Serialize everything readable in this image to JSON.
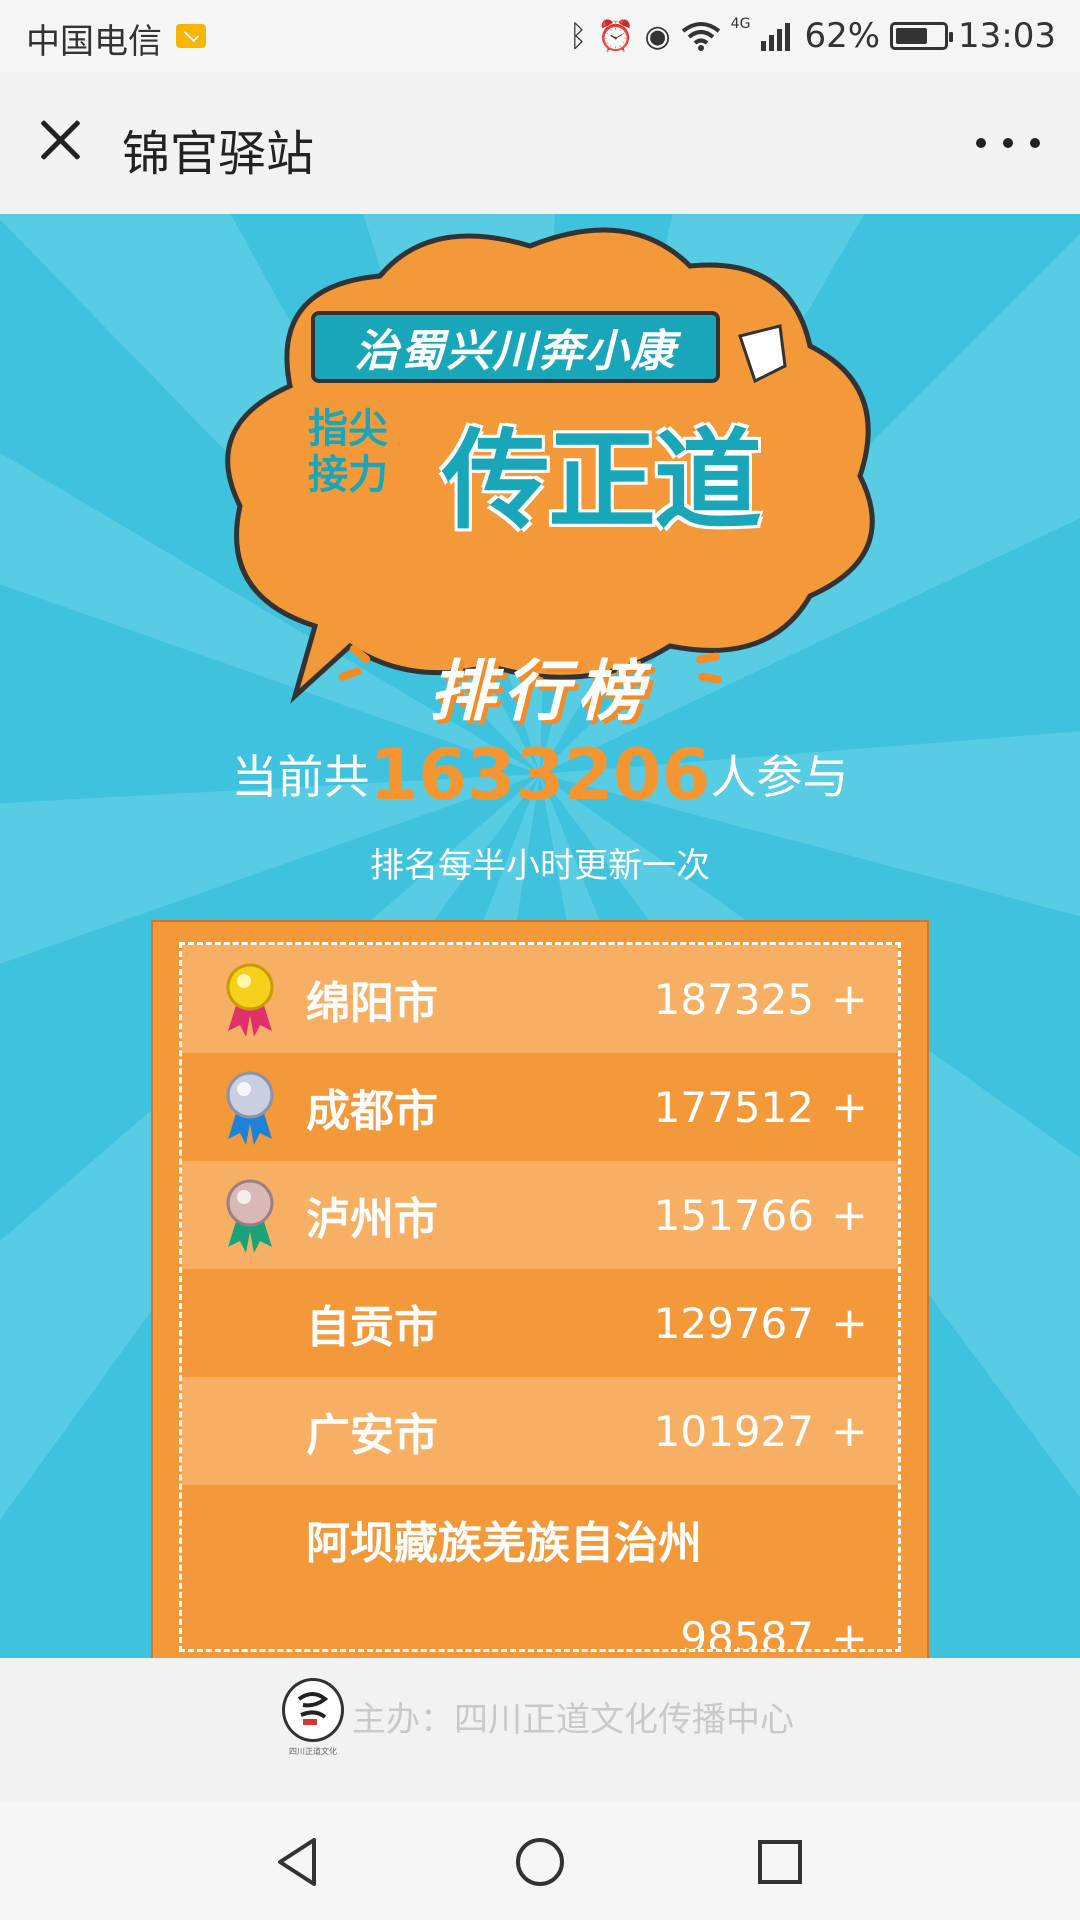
{
  "status_bar": {
    "carrier": "中国电信",
    "network": "4G",
    "battery": "62%",
    "battery_level": 0.62,
    "time": "13:03"
  },
  "header": {
    "title": "锦官驿站"
  },
  "banner": {
    "slogan_top": "治蜀兴川奔小康",
    "slogan_small_1": "指尖",
    "slogan_small_2": "接力",
    "slogan_main": "传正道"
  },
  "leaderboard": {
    "title": "排行榜",
    "participants_prefix": "当前共",
    "participants_count": "1633206",
    "participants_suffix": "人参与",
    "update_note": "排名每半小时更新一次",
    "rows": [
      {
        "city": "绵阳市",
        "score": "187325",
        "plus": "+",
        "medal": "gold"
      },
      {
        "city": "成都市",
        "score": "177512",
        "plus": "+",
        "medal": "silver"
      },
      {
        "city": "泸州市",
        "score": "151766",
        "plus": "+",
        "medal": "bronze"
      },
      {
        "city": "自贡市",
        "score": "129767",
        "plus": "+"
      },
      {
        "city": "广安市",
        "score": "101927",
        "plus": "+"
      },
      {
        "city": "阿坝藏族羌族自治州",
        "score": "98587",
        "plus": "+"
      }
    ]
  },
  "footer": {
    "organizer": "主办：四川正道文化传播中心",
    "logo_caption": "四川正道文化"
  },
  "colors": {
    "sky": "#3fc2dd",
    "orange": "#f3993a",
    "orange_light": "#f7b063",
    "teal_text": "#19a6b8"
  }
}
